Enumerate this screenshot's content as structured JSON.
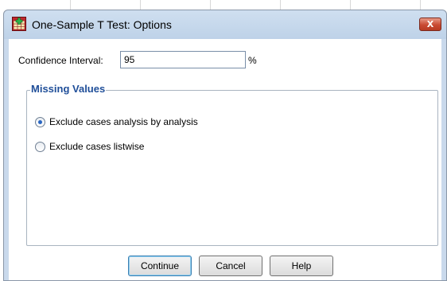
{
  "dialog": {
    "title": "One-Sample T Test: Options",
    "close_label": "X"
  },
  "confidence": {
    "label": "Confidence Interval:",
    "value": "95",
    "unit": "%"
  },
  "missing_values": {
    "legend": "Missing Values",
    "options": [
      {
        "label": "Exclude cases analysis by analysis",
        "checked": true
      },
      {
        "label": "Exclude cases listwise",
        "checked": false
      }
    ]
  },
  "buttons": {
    "continue": "Continue",
    "cancel": "Cancel",
    "help": "Help"
  },
  "colors": {
    "legend": "#1f4e99",
    "frame": "#c9d9ec",
    "close": "#c94a33"
  }
}
